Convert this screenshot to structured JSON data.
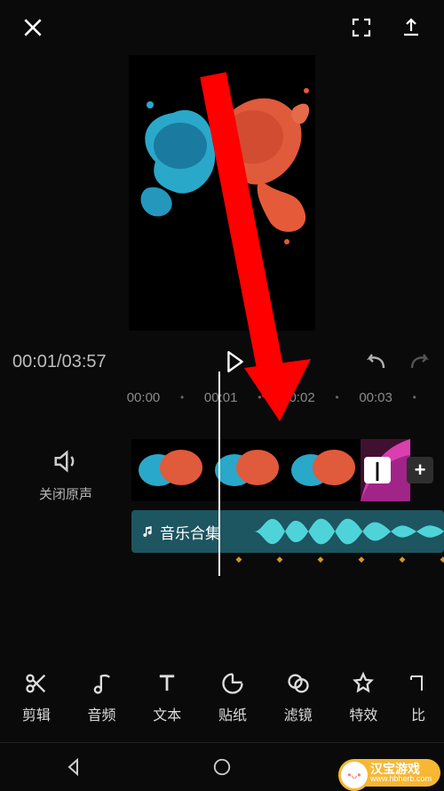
{
  "header": {},
  "playbar": {
    "time": "00:01/03:57"
  },
  "ruler": {
    "t0": "00:00",
    "t1": "00:01",
    "t2": "00:02",
    "t3": "00:03"
  },
  "mute": {
    "label": "关闭原声"
  },
  "buttons": {
    "minus": "|",
    "plus": "+"
  },
  "audio": {
    "label": "音乐合集"
  },
  "toolbar": {
    "edit": "剪辑",
    "audio": "音频",
    "text": "文本",
    "sticker": "贴纸",
    "filter": "滤镜",
    "effect": "特效",
    "ratio": "比"
  },
  "watermark": {
    "title": "汉宝游戏",
    "sub": "www.hbherb.com",
    "face": "•ᴗ•"
  }
}
